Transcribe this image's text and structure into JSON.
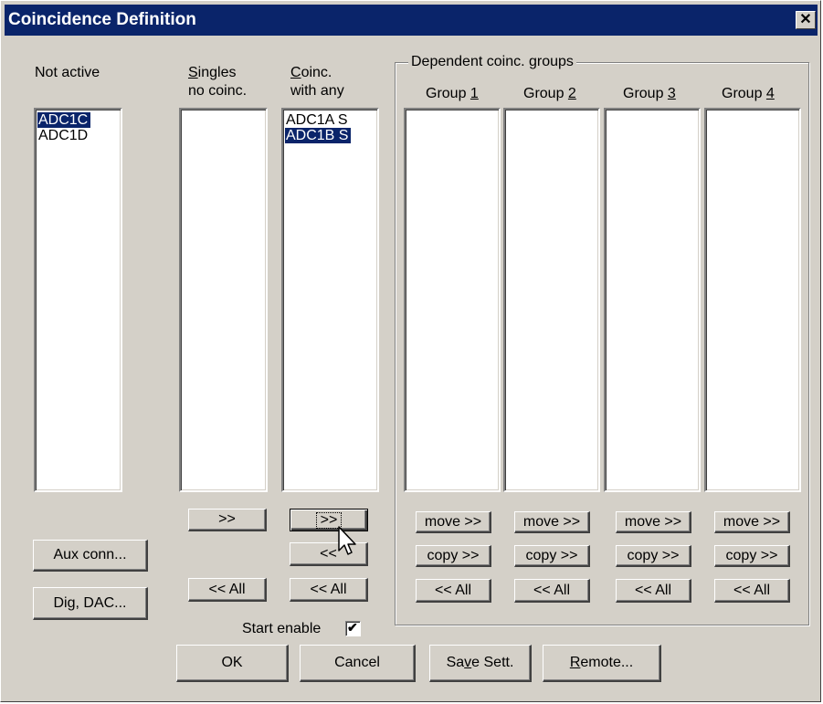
{
  "window": {
    "title": "Coincidence Definition",
    "close_glyph": "✕"
  },
  "columns": {
    "not_active": {
      "header": "Not active",
      "items": [
        {
          "label": "ADC1C",
          "selected": true
        },
        {
          "label": "ADC1D",
          "selected": false
        }
      ]
    },
    "singles": {
      "header_line1_u": "S",
      "header_line1_rest": "ingles",
      "header_line2": "no coinc.",
      "items": []
    },
    "coinc_any": {
      "header_line1_u": "C",
      "header_line1_rest": "oinc.",
      "header_line2": "with any",
      "items": [
        {
          "label": "ADC1A S",
          "selected": false
        },
        {
          "label": "ADC1B S",
          "selected": true
        }
      ]
    }
  },
  "dependent_groups": {
    "title": "Dependent coinc. groups",
    "groups": [
      {
        "prefix": "Group ",
        "num": "1"
      },
      {
        "prefix": "Group ",
        "num": "2"
      },
      {
        "prefix": "Group ",
        "num": "3"
      },
      {
        "prefix": "Group ",
        "num": "4"
      }
    ]
  },
  "buttons": {
    "move": "move >>",
    "copy": "copy >>",
    "all_back": "<< All",
    "move_right": ">>",
    "move_left": "<<",
    "aux_conn": "Aux conn...",
    "dig_dac": "Dig, DAC...",
    "ok": "OK",
    "cancel": "Cancel",
    "save_pre": "Sa",
    "save_u": "v",
    "save_post": "e Sett.",
    "remote_u": "R",
    "remote_post": "emote..."
  },
  "start_enable": {
    "label": "Start enable",
    "checked": true,
    "check_glyph": "✔"
  },
  "icons": {
    "cursor": "arrow-pointer-icon"
  }
}
